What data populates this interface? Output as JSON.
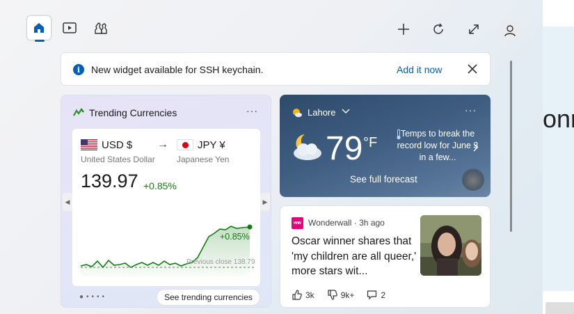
{
  "toolbar": {
    "home": "home-icon",
    "video": "play-icon",
    "games": "chess-icon",
    "add": "plus-icon",
    "refresh": "refresh-icon",
    "expand": "expand-icon",
    "profile": "person-icon"
  },
  "notice": {
    "message": "New widget available for SSH keychain.",
    "action": "Add it now"
  },
  "currency": {
    "title": "Trending Currencies",
    "from_code": "USD $",
    "from_name": "United States Dollar",
    "to_code": "JPY ¥",
    "to_name": "Japanese Yen",
    "rate": "139.97",
    "change": "+0.85%",
    "chart_change": "+0.85%",
    "previous_close": "Previous close 138.79",
    "see_more": "See trending currencies",
    "chart_color": "#107c10"
  },
  "weather": {
    "location": "Lahore",
    "temperature": "79",
    "unit": "°F",
    "headline": "Temps to break the record low for June 3 in a few...",
    "forecast": "See full forecast"
  },
  "news": {
    "source": "Wonderwall · 3h ago",
    "source_logo": "ww",
    "headline": "Oscar winner shares that 'my children are all queer,' more stars wit...",
    "likes": "3k",
    "dislikes": "9k+",
    "comments": "2"
  },
  "background_text": "onr",
  "colors": {
    "accent": "#005fb8",
    "positive": "#107c10"
  }
}
